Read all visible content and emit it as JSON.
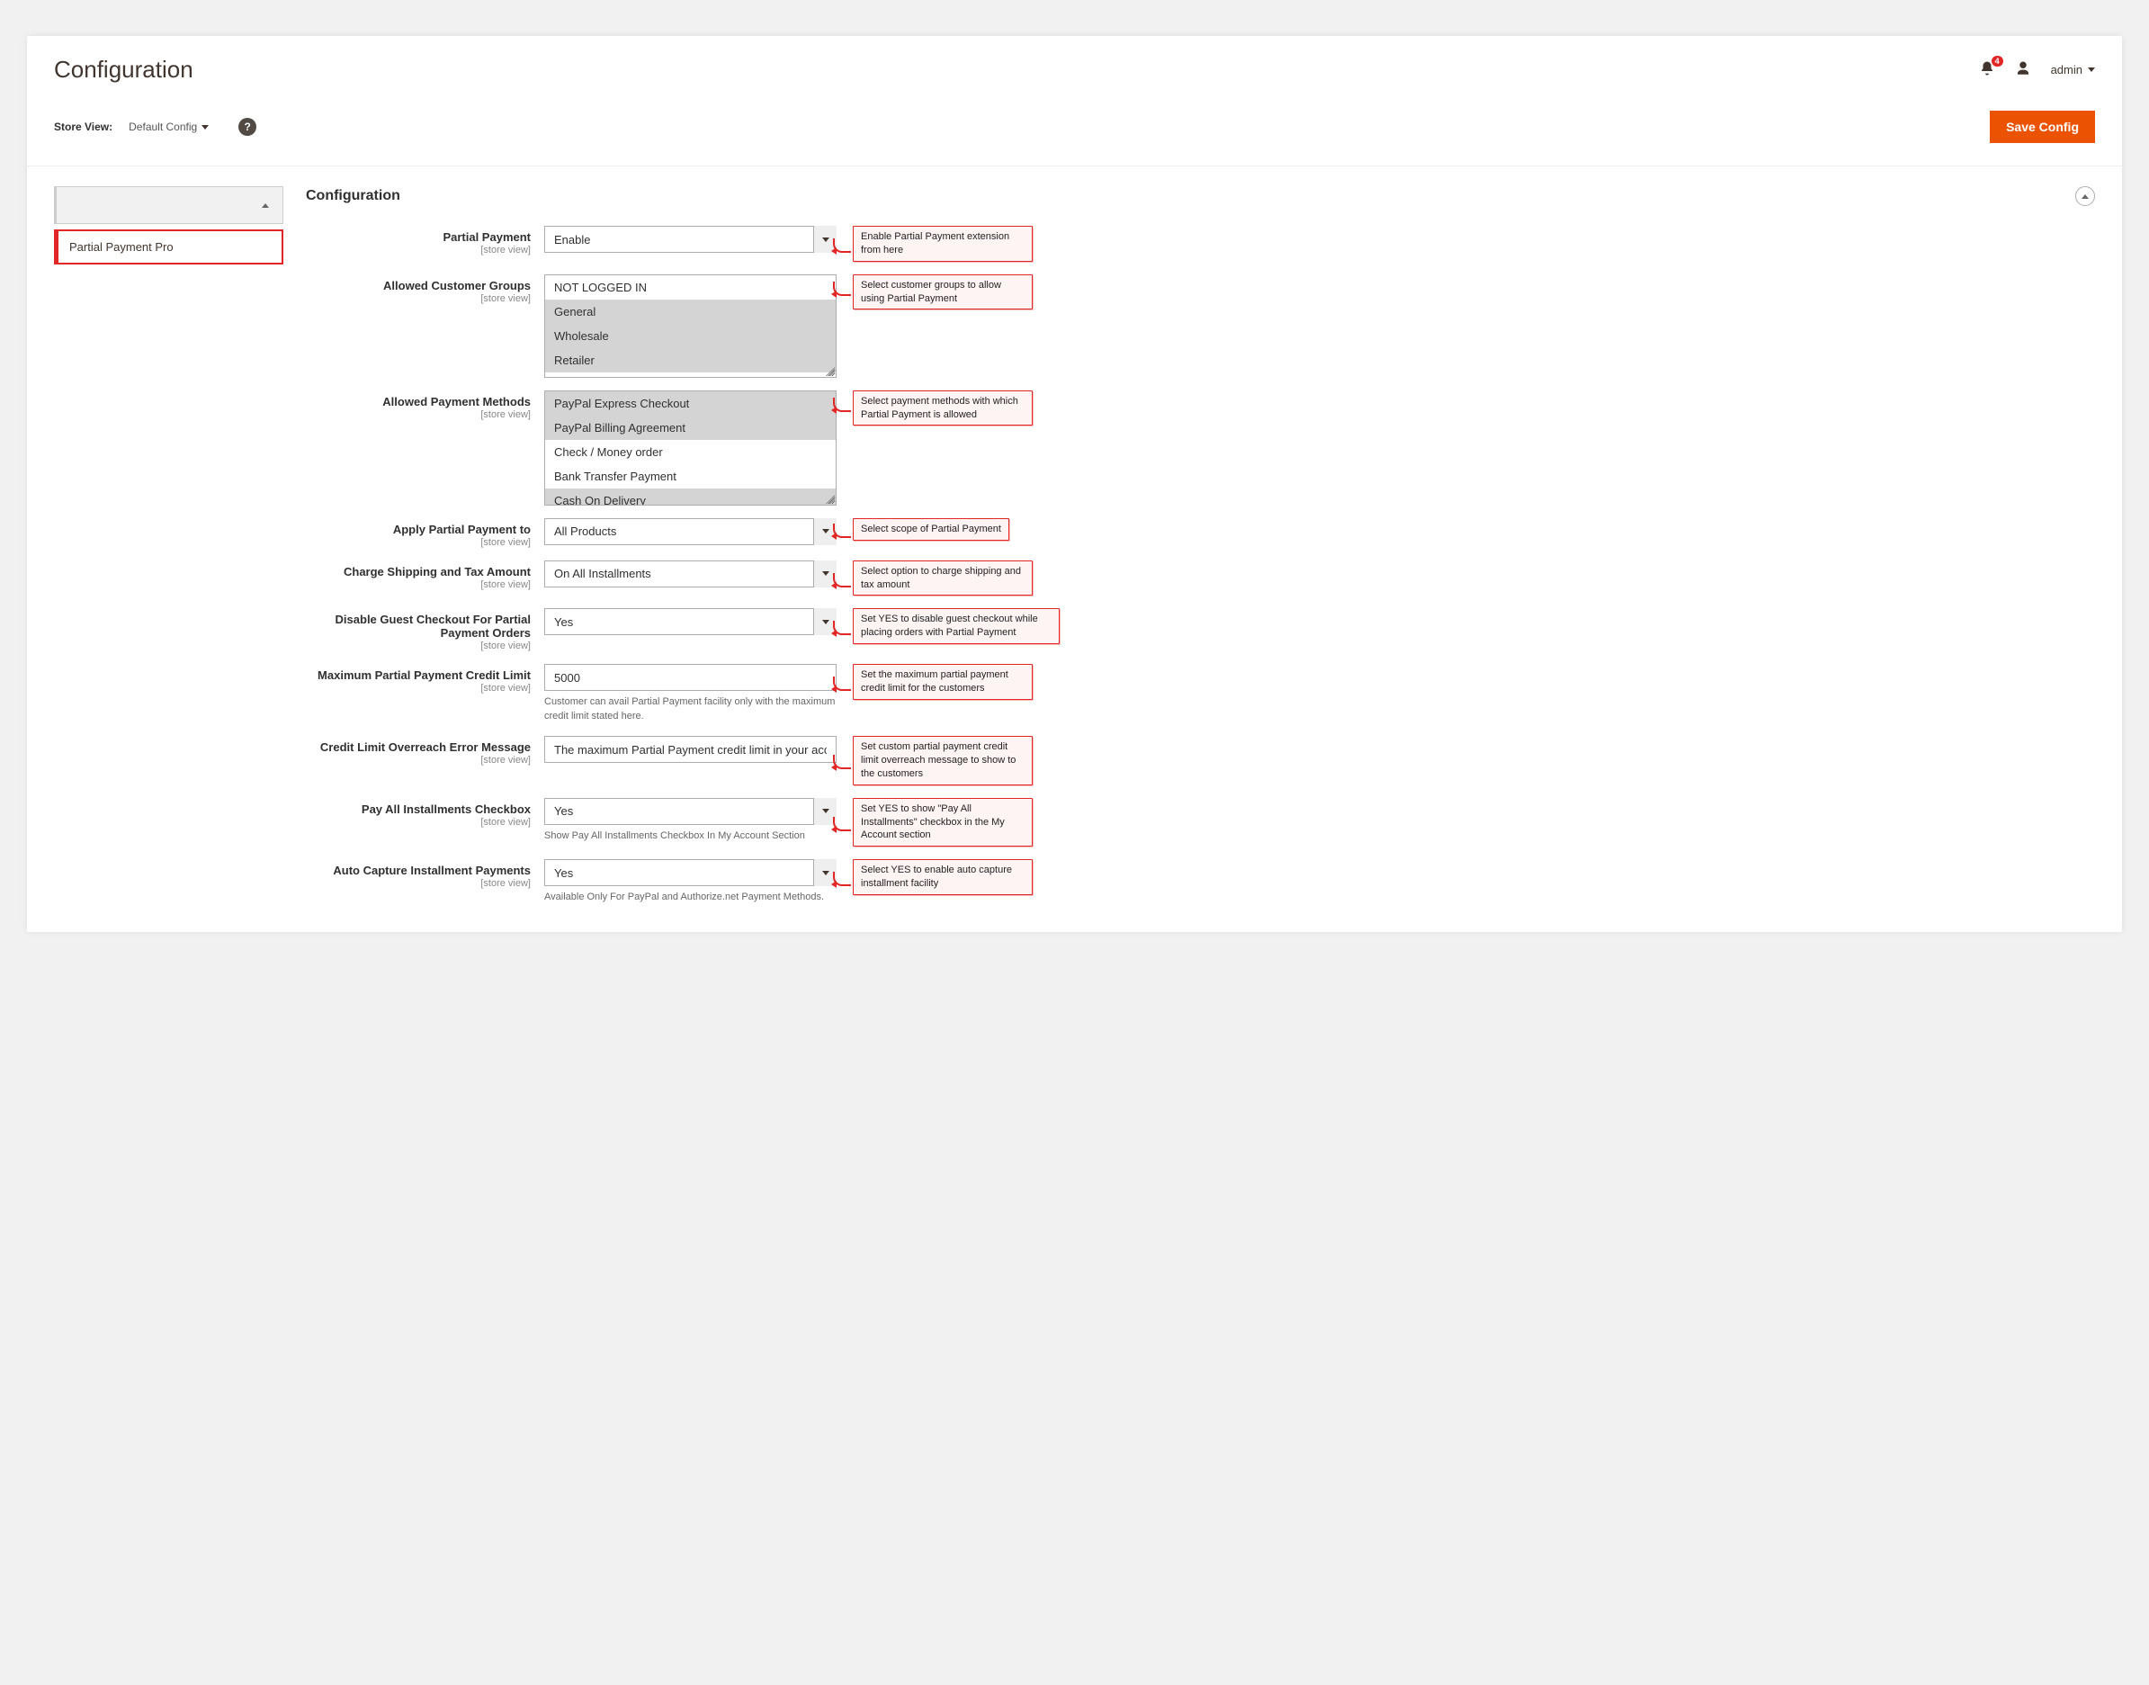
{
  "header": {
    "title": "Configuration",
    "notification_count": "4",
    "admin_label": "admin"
  },
  "toolbar": {
    "store_view_label": "Store View:",
    "store_view_value": "Default Config",
    "save_button": "Save Config"
  },
  "sidebar": {
    "active_tab": "Partial Payment Pro"
  },
  "section": {
    "title": "Configuration"
  },
  "fields": {
    "partial_payment": {
      "label": "Partial Payment",
      "scope": "[store view]",
      "value": "Enable"
    },
    "customer_groups": {
      "label": "Allowed Customer Groups",
      "scope": "[store view]",
      "options": [
        {
          "text": "NOT LOGGED IN",
          "selected": false
        },
        {
          "text": "General",
          "selected": true
        },
        {
          "text": "Wholesale",
          "selected": true
        },
        {
          "text": "Retailer",
          "selected": true
        }
      ]
    },
    "payment_methods": {
      "label": "Allowed Payment Methods",
      "scope": "[store view]",
      "options": [
        {
          "text": "PayPal Express Checkout",
          "selected": true
        },
        {
          "text": "PayPal Billing Agreement",
          "selected": true
        },
        {
          "text": "Check / Money order",
          "selected": false
        },
        {
          "text": "Bank Transfer Payment",
          "selected": false
        },
        {
          "text": "Cash On Delivery",
          "selected": true
        }
      ]
    },
    "apply_to": {
      "label": "Apply Partial Payment to",
      "scope": "[store view]",
      "value": "All Products"
    },
    "charge_shipping": {
      "label": "Charge Shipping and Tax Amount",
      "scope": "[store view]",
      "value": "On All Installments"
    },
    "disable_guest": {
      "label": "Disable Guest Checkout For Partial Payment Orders",
      "scope": "[store view]",
      "value": "Yes"
    },
    "credit_limit": {
      "label": "Maximum Partial Payment Credit Limit",
      "scope": "[store view]",
      "value": "5000",
      "note": "Customer can avail Partial Payment facility only with the maximum credit limit stated here."
    },
    "overreach_msg": {
      "label": "Credit Limit Overreach Error Message",
      "scope": "[store view]",
      "value": "The maximum Partial Payment credit limit in your account is overrea"
    },
    "pay_all": {
      "label": "Pay All Installments Checkbox",
      "scope": "[store view]",
      "value": "Yes",
      "note": "Show Pay All Installments Checkbox In My Account Section"
    },
    "auto_capture": {
      "label": "Auto Capture Installment Payments",
      "scope": "[store view]",
      "value": "Yes",
      "note": "Available Only For PayPal and Authorize.net Payment Methods."
    }
  },
  "callouts": {
    "partial_payment": "Enable Partial Payment extension from here",
    "customer_groups": "Select customer groups to allow using Partial Payment",
    "payment_methods": "Select payment methods with which Partial Payment is allowed",
    "apply_to": "Select scope of Partial Payment",
    "charge_shipping": "Select option to charge shipping and tax amount",
    "disable_guest": "Set YES to disable guest checkout while placing orders with Partial Payment",
    "credit_limit": "Set the maximum partial payment credit limit for the customers",
    "overreach_msg": "Set custom partial payment credit limit overreach message to show to the customers",
    "pay_all": "Set YES to show \"Pay All Installments\" checkbox in the My Account section",
    "auto_capture": "Select YES to enable auto capture installment facility"
  }
}
